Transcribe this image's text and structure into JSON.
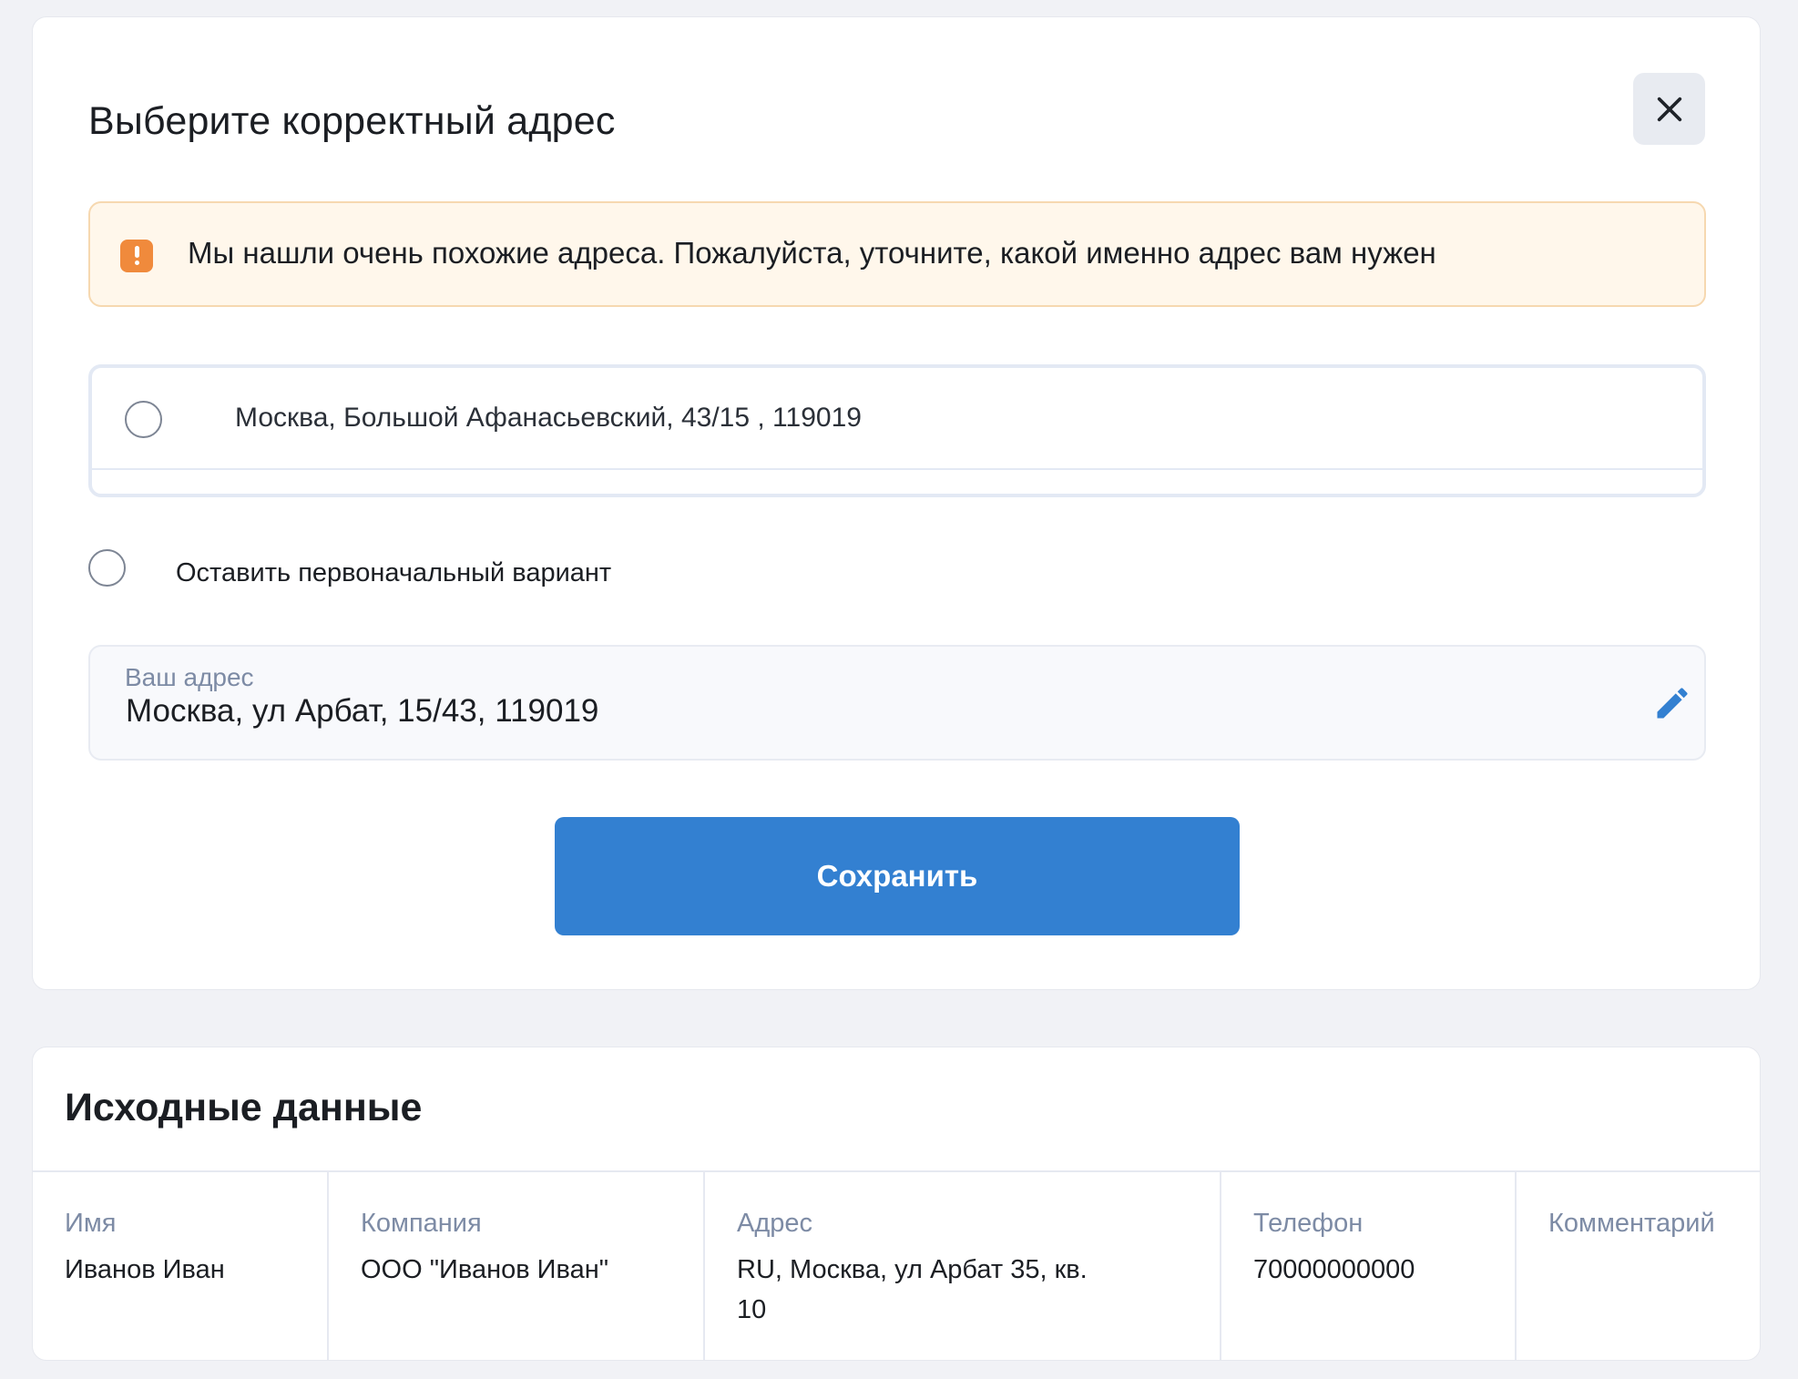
{
  "modal": {
    "title": "Выберите корректный адрес",
    "close_icon": "close-icon",
    "warning": {
      "icon": "exclamation-icon",
      "color": "#f08a3c",
      "text": "Мы нашли очень похожие адреса. Пожалуйста, уточните, какой именно адрес вам нужен"
    },
    "suggestions": [
      {
        "label": "Москва, Большой Афанасьевский, 43/15 , 119019",
        "selected": false
      }
    ],
    "keep_original": {
      "label": "Оставить первоначальный вариант",
      "selected": false
    },
    "your_address": {
      "label": "Ваш адрес",
      "value": "Москва, ул Арбат, 15/43, 119019",
      "edit_icon": "pencil-icon"
    },
    "save_label": "Сохранить",
    "accent_color": "#3380d1"
  },
  "source": {
    "title": "Исходные данные",
    "columns": [
      {
        "header": "Имя",
        "value": "Иванов Иван"
      },
      {
        "header": "Компания",
        "value": "ООО \"Иванов Иван\""
      },
      {
        "header": "Адрес",
        "value": "RU, Москва, ул Арбат 35, кв. 10"
      },
      {
        "header": "Телефон",
        "value": "70000000000"
      },
      {
        "header": "Комментарий",
        "value": ""
      }
    ]
  }
}
